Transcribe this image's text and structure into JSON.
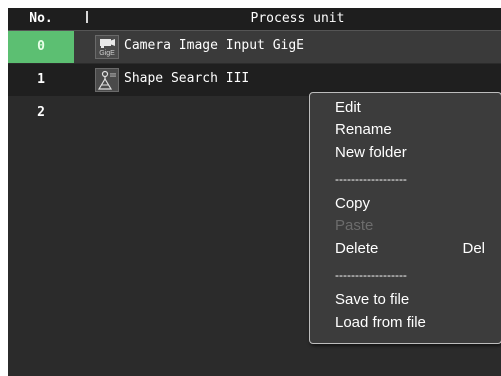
{
  "header": {
    "no_label": "No.",
    "unit_label": "Process unit"
  },
  "rows": [
    {
      "no": "0",
      "icon": "camera-gige-icon",
      "label": "Camera Image Input GigE",
      "state": "selected"
    },
    {
      "no": "1",
      "icon": "shape-search-icon",
      "label": "Shape Search III",
      "state": "focused"
    },
    {
      "no": "2",
      "icon": "",
      "label": "",
      "state": "empty"
    }
  ],
  "icon_text": {
    "gige": "GigE",
    "shape_search": "III"
  },
  "context_menu": {
    "edit": "Edit",
    "rename": "Rename",
    "new_folder": "New folder",
    "separator_1": "------------------",
    "copy": "Copy",
    "paste": "Paste",
    "delete": "Delete",
    "delete_shortcut": "Del",
    "separator_2": "------------------",
    "save_to_file": "Save to file",
    "load_from_file": "Load from file"
  },
  "colors": {
    "panel_bg": "#2b2b2b",
    "selected_number_bg": "#5cbf72",
    "menu_bg": "#3c3c3c",
    "disabled_text": "#6c6c6c"
  }
}
